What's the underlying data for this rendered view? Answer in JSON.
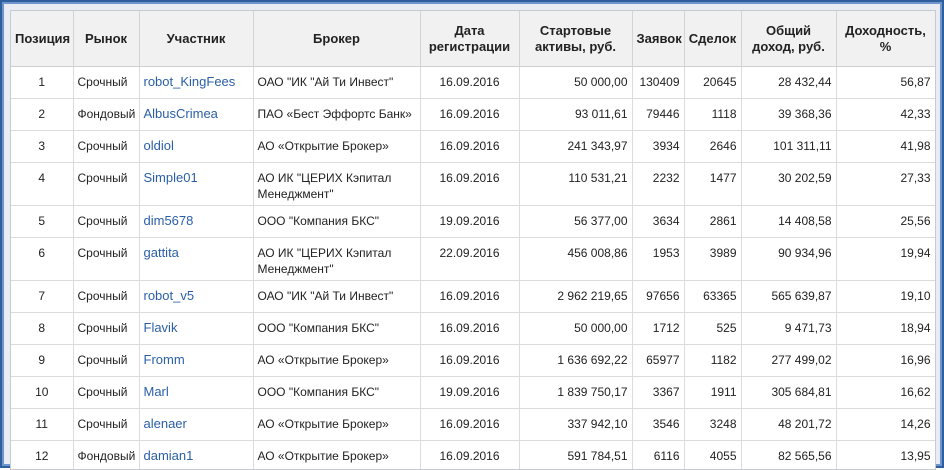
{
  "table": {
    "headers": {
      "position": "Позиция",
      "market": "Рынок",
      "participant": "Участник",
      "broker": "Брокер",
      "reg_date": "Дата регистрации",
      "start_assets": "Стартовые активы, руб.",
      "orders": "Заявок",
      "deals": "Сделок",
      "total_income": "Общий доход, руб.",
      "yield": "Доходность, %"
    },
    "rows": [
      {
        "position": "1",
        "market": "Срочный",
        "participant": "robot_KingFees",
        "broker": "ОАО \"ИК \"Ай Ти Инвест\"",
        "reg_date": "16.09.2016",
        "start_assets": "50 000,00",
        "orders": "130409",
        "deals": "20645",
        "total_income": "28 432,44",
        "yield": "56,87"
      },
      {
        "position": "2",
        "market": "Фондовый",
        "participant": "AlbusCrimea",
        "broker": "ПАО «Бест Эффортс Банк»",
        "reg_date": "16.09.2016",
        "start_assets": "93 011,61",
        "orders": "79446",
        "deals": "1118",
        "total_income": "39 368,36",
        "yield": "42,33"
      },
      {
        "position": "3",
        "market": "Срочный",
        "participant": "oldiol",
        "broker": "АО «Открытие Брокер»",
        "reg_date": "16.09.2016",
        "start_assets": "241 343,97",
        "orders": "3934",
        "deals": "2646",
        "total_income": "101 311,11",
        "yield": "41,98"
      },
      {
        "position": "4",
        "market": "Срочный",
        "participant": "Simple01",
        "broker": "АО ИК \"ЦЕРИХ Кэпитал Менеджмент\"",
        "reg_date": "16.09.2016",
        "start_assets": "110 531,21",
        "orders": "2232",
        "deals": "1477",
        "total_income": "30 202,59",
        "yield": "27,33"
      },
      {
        "position": "5",
        "market": "Срочный",
        "participant": "dim5678",
        "broker": "ООО \"Компания БКС\"",
        "reg_date": "19.09.2016",
        "start_assets": "56 377,00",
        "orders": "3634",
        "deals": "2861",
        "total_income": "14 408,58",
        "yield": "25,56"
      },
      {
        "position": "6",
        "market": "Срочный",
        "participant": "gattita",
        "broker": "АО ИК \"ЦЕРИХ Кэпитал Менеджмент\"",
        "reg_date": "22.09.2016",
        "start_assets": "456 008,86",
        "orders": "1953",
        "deals": "3989",
        "total_income": "90 934,96",
        "yield": "19,94"
      },
      {
        "position": "7",
        "market": "Срочный",
        "participant": "robot_v5",
        "broker": "ОАО \"ИК \"Ай Ти Инвест\"",
        "reg_date": "16.09.2016",
        "start_assets": "2 962 219,65",
        "orders": "97656",
        "deals": "63365",
        "total_income": "565 639,87",
        "yield": "19,10"
      },
      {
        "position": "8",
        "market": "Срочный",
        "participant": "Flavik",
        "broker": "ООО \"Компания БКС\"",
        "reg_date": "16.09.2016",
        "start_assets": "50 000,00",
        "orders": "1712",
        "deals": "525",
        "total_income": "9 471,73",
        "yield": "18,94"
      },
      {
        "position": "9",
        "market": "Срочный",
        "participant": "Fromm",
        "broker": "АО «Открытие Брокер»",
        "reg_date": "16.09.2016",
        "start_assets": "1 636 692,22",
        "orders": "65977",
        "deals": "1182",
        "total_income": "277 499,02",
        "yield": "16,96"
      },
      {
        "position": "10",
        "market": "Срочный",
        "participant": "Marl",
        "broker": "ООО \"Компания БКС\"",
        "reg_date": "19.09.2016",
        "start_assets": "1 839 750,17",
        "orders": "3367",
        "deals": "1911",
        "total_income": "305 684,81",
        "yield": "16,62"
      },
      {
        "position": "11",
        "market": "Срочный",
        "participant": "alenaer",
        "broker": "АО «Открытие Брокер»",
        "reg_date": "16.09.2016",
        "start_assets": "337 942,10",
        "orders": "3546",
        "deals": "3248",
        "total_income": "48 201,72",
        "yield": "14,26"
      },
      {
        "position": "12",
        "market": "Фондовый",
        "participant": "damian1",
        "broker": "АО «Открытие Брокер»",
        "reg_date": "16.09.2016",
        "start_assets": "591 784,51",
        "orders": "6116",
        "deals": "4055",
        "total_income": "82 565,56",
        "yield": "13,95"
      }
    ]
  },
  "colors": {
    "frame_border": "#2f5e9e",
    "link": "#2a5fa8",
    "header_bg": "#f1f1f1"
  }
}
